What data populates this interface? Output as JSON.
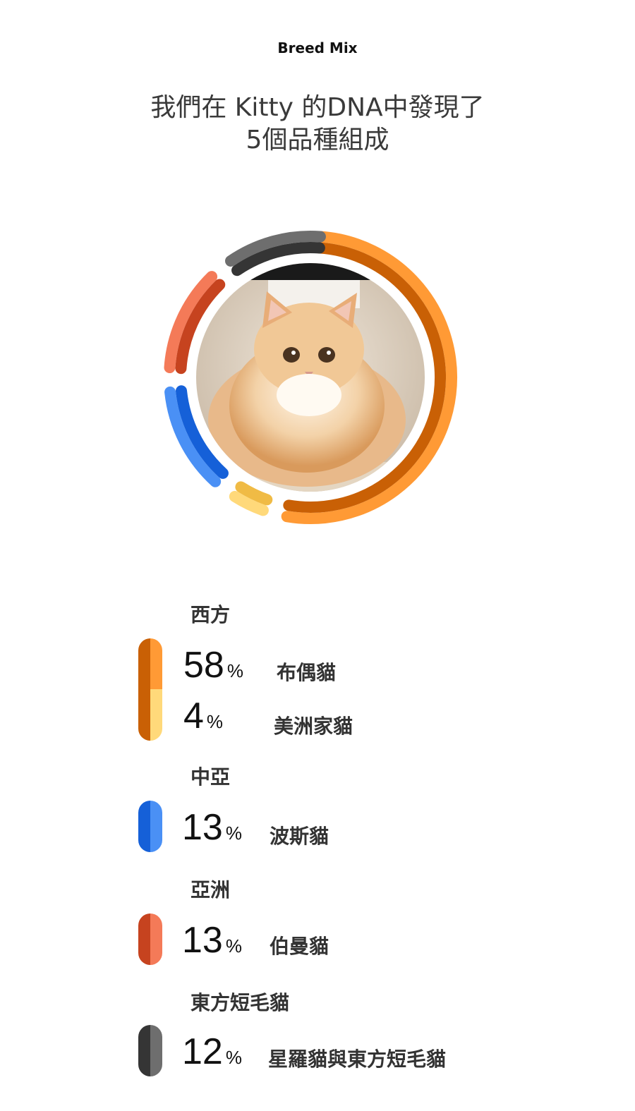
{
  "header": {
    "label": "Breed Mix"
  },
  "headline": {
    "line1": "我們在 Kitty 的DNA中發現了",
    "line2": "5個品種組成"
  },
  "avatar": {
    "subject": "cat-photo"
  },
  "ring_segments": [
    {
      "name": "布偶貓",
      "percent": 58,
      "color_outer": "#ff9a35",
      "color_inner": "#c96005"
    },
    {
      "name": "美洲家貓",
      "percent": 4,
      "color_outer": "#ffd97a",
      "color_inner": "#f0bb45"
    },
    {
      "name": "波斯貓",
      "percent": 13,
      "color_outer": "#4a90f5",
      "color_inner": "#1560d8"
    },
    {
      "name": "伯曼貓",
      "percent": 13,
      "color_outer": "#f47a58",
      "color_inner": "#c6431f"
    },
    {
      "name": "星羅貓與東方短毛貓",
      "percent": 12,
      "color_outer": "#6e6e6e",
      "color_inner": "#353535"
    }
  ],
  "groups": [
    {
      "label": "西方",
      "items": [
        {
          "percent": "58",
          "symbol": "%",
          "breed": "布偶貓",
          "color_left": "#c96005",
          "color_right": "#ff9a35"
        },
        {
          "percent": "4",
          "symbol": "%",
          "breed": "美洲家貓",
          "color_left": "#c96005",
          "color_right": "#ffd97a"
        }
      ]
    },
    {
      "label": "中亞",
      "items": [
        {
          "percent": "13",
          "symbol": "%",
          "breed": "波斯貓",
          "color_left": "#1560d8",
          "color_right": "#4a90f5"
        }
      ]
    },
    {
      "label": "亞洲",
      "items": [
        {
          "percent": "13",
          "symbol": "%",
          "breed": "伯曼貓",
          "color_left": "#c6431f",
          "color_right": "#f47a58"
        }
      ]
    },
    {
      "label": "東方短毛貓",
      "items": [
        {
          "percent": "12",
          "symbol": "%",
          "breed": "星羅貓與東方短毛貓",
          "color_left": "#353535",
          "color_right": "#6e6e6e"
        }
      ]
    }
  ]
}
